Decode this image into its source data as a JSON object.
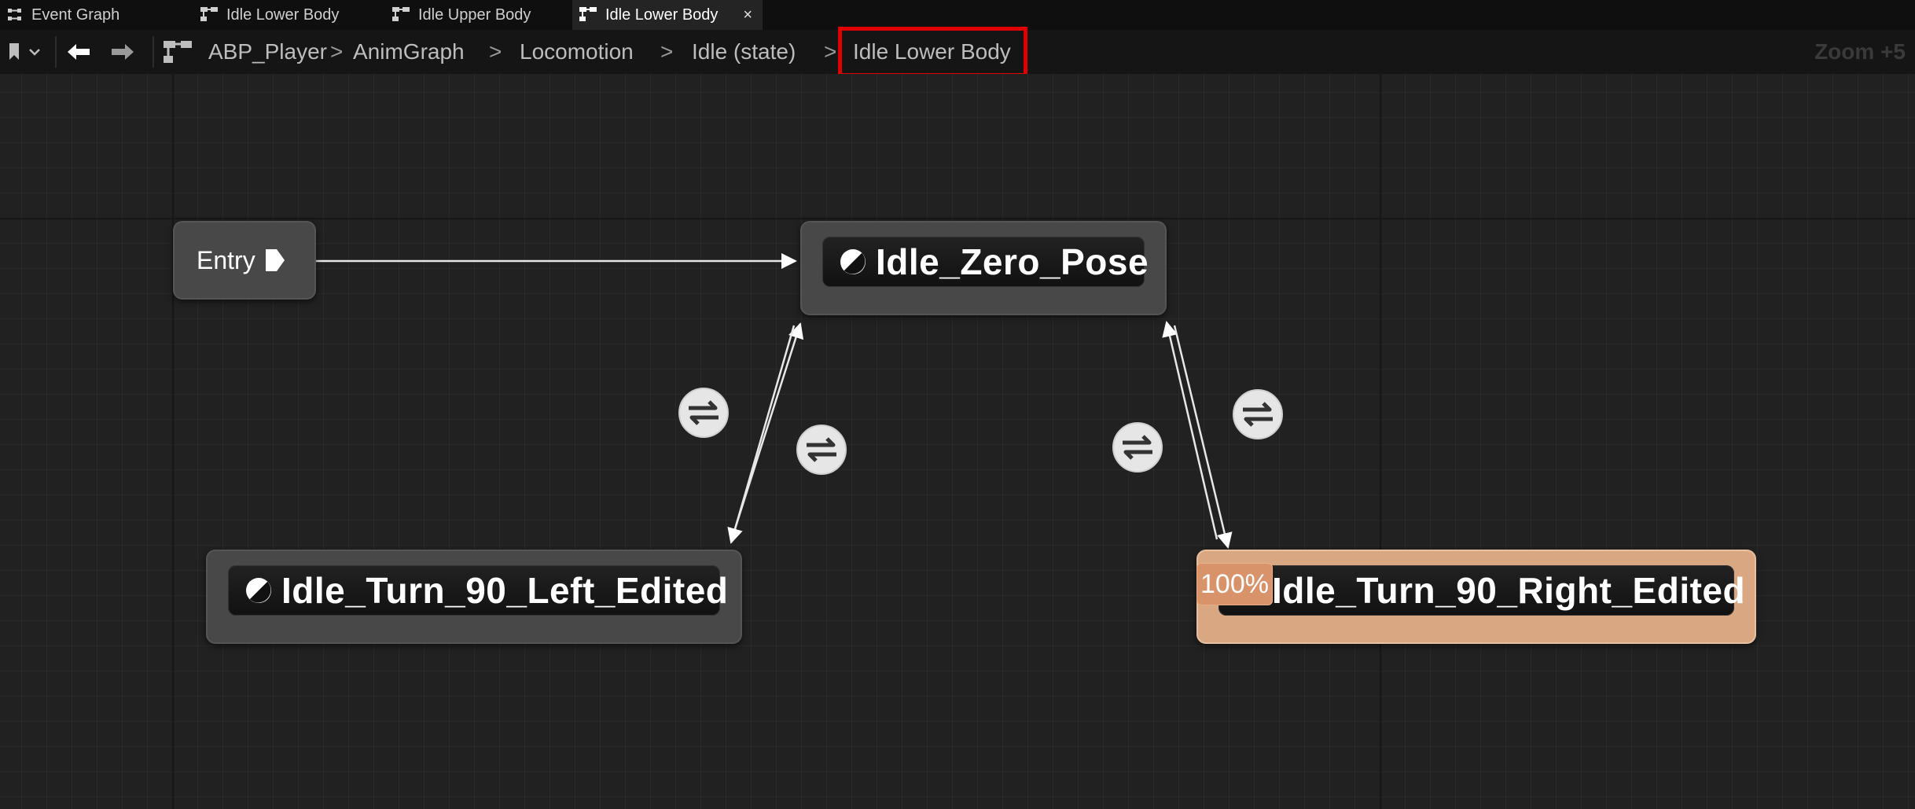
{
  "tabs": [
    {
      "label": "Event Graph",
      "icon": "event-graph-icon",
      "active": false
    },
    {
      "label": "Idle Lower Body",
      "icon": "state-machine-icon",
      "active": false
    },
    {
      "label": "Idle Upper Body",
      "icon": "state-machine-icon",
      "active": false
    },
    {
      "label": "Idle Lower Body",
      "icon": "state-machine-icon",
      "active": true,
      "close": "×"
    }
  ],
  "toolbar": {
    "bookmark_icon": "bookmark-icon",
    "back_icon": "back-arrow-icon",
    "forward_icon": "forward-arrow-icon",
    "graph_icon": "state-machine-icon",
    "breadcrumbs": [
      "ABP_Player",
      "AnimGraph",
      "Locomotion",
      "Idle (state)",
      "Idle Lower Body"
    ],
    "separator": ">",
    "zoom": "Zoom +5"
  },
  "graph": {
    "entry": {
      "label": "Entry"
    },
    "states": {
      "zero": {
        "label": "Idle_Zero_Pose"
      },
      "left": {
        "label": "Idle_Turn_90_Left_Edited"
      },
      "right": {
        "label": "Idle_Turn_90_Right_Edited",
        "active": true
      }
    },
    "transition_icon": "transition-rule-icon",
    "active_weight": "100%"
  },
  "colors": {
    "canvas": "#212121",
    "node_gray": "#484848",
    "node_active": "#d9a883",
    "weight_badge": "#d9936a",
    "highlight": "#e10000"
  }
}
